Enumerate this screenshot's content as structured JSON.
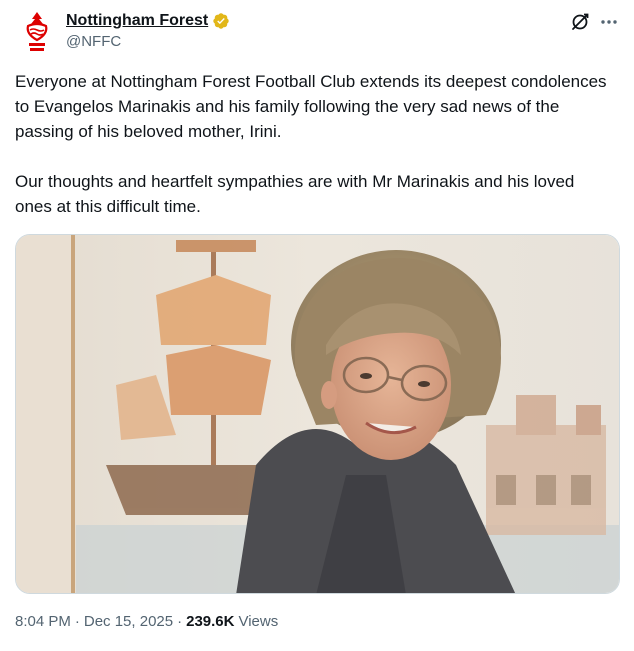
{
  "author": {
    "display_name": "Nottingham Forest",
    "handle": "@NFFC"
  },
  "tweet": {
    "paragraph_1": "Everyone at Nottingham Forest Football Club extends its deepest condolences to Evangelos Marinakis and his family following the very sad news of the passing of his beloved mother, Irini.",
    "paragraph_2": "Our thoughts and heartfelt sympathies are with Mr Marinakis and his loved ones at this difficult time."
  },
  "meta": {
    "time": "8:04 PM",
    "separator_1": "·",
    "date": "Dec 15, 2025",
    "separator_2": "·",
    "views_count": "239.6K",
    "views_label": "Views"
  },
  "icons": {
    "avatar": "nottingham-forest-crest",
    "verified": "verified-badge-gold",
    "grok": "grok-icon",
    "more": "more-icon"
  },
  "colors": {
    "text_primary": "#0f1419",
    "text_secondary": "#536471",
    "verified_gold": "#e2b719",
    "crest_red": "#dd0000"
  }
}
